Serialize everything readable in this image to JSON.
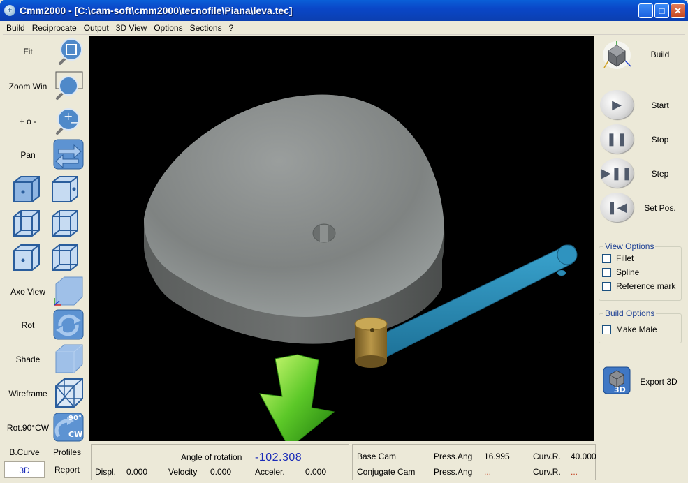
{
  "window": {
    "title": "Cmm2000 - [C:\\cam-soft\\cmm2000\\tecnofile\\Piana\\leva.tec]",
    "controls": [
      "_",
      "□",
      "✕"
    ]
  },
  "menu": [
    "Build",
    "Reciprocate",
    "Output",
    "3D View",
    "Options",
    "Sections",
    "?"
  ],
  "left_tools": [
    {
      "label": "Fit",
      "icon": "zoom-fit-icon"
    },
    {
      "label": "Zoom Win",
      "icon": "zoom-window-icon"
    },
    {
      "label": "+ o -",
      "icon": "zoom-in-out-icon"
    },
    {
      "label": "Pan",
      "icon": "pan-arrows-icon"
    },
    {
      "label": "Axo View",
      "icon": "axo-view-cube-icon"
    },
    {
      "label": "Rot",
      "icon": "rotate-icon"
    },
    {
      "label": "Shade",
      "icon": "shade-cube-icon"
    },
    {
      "label": "Wireframe",
      "icon": "wireframe-cube-icon"
    },
    {
      "label": "Rot.90°CW",
      "icon": "rotate-90-cw-icon",
      "badge_top": "90°",
      "badge_bottom": "CW"
    }
  ],
  "bottom_left": {
    "bcurve": "B.Curve",
    "profiles": "Profiles",
    "tab_3d": "3D",
    "report": "Report"
  },
  "right_tools": {
    "build": "Build",
    "start": "Start",
    "stop": "Stop",
    "step": "Step",
    "set_pos": "Set Pos.",
    "export_3d": "Export 3D",
    "export_badge": "3D"
  },
  "view_options": {
    "title": "View Options",
    "items": [
      {
        "label": "Fillet",
        "checked": false
      },
      {
        "label": "Spline",
        "checked": false
      },
      {
        "label": "Reference mark",
        "checked": false
      }
    ]
  },
  "build_options": {
    "title": "Build Options",
    "items": [
      {
        "label": "Make Male",
        "checked": false
      }
    ]
  },
  "status": {
    "angle_label": "Angle of rotation",
    "angle_value": "-102.308",
    "displ_label": "Displ.",
    "displ_value": "0.000",
    "velocity_label": "Velocity",
    "velocity_value": "0.000",
    "acceler_label": "Acceler.",
    "acceler_value": "0.000",
    "base_cam_label": "Base Cam",
    "conjugate_cam_label": "Conjugate Cam",
    "press_ang_label": "Press.Ang",
    "press_ang_value": "16.995",
    "press_ang_value2": "...",
    "curv_r_label": "Curv.R.",
    "curv_r_value": "40.000",
    "curv_r_value2": "..."
  },
  "colors": {
    "titlebar": "#0a47c8",
    "viewport_bg": "#000000",
    "cam": "#8a8d8c",
    "follower_arm": "#2e86b0",
    "roller": "#b08a3a",
    "arrow": "#3fa81a",
    "value_blue": "#1a2bb8",
    "value_red": "#c23b1a"
  }
}
